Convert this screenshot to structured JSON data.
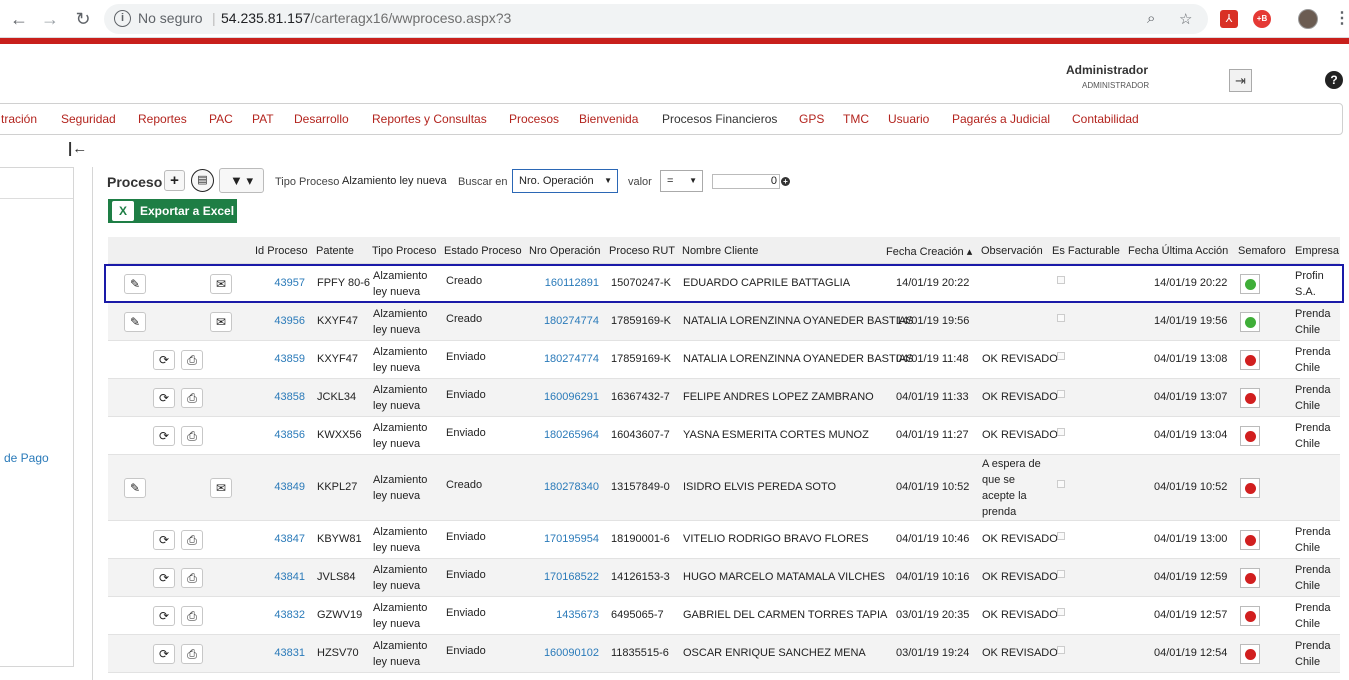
{
  "browser": {
    "security_label": "No seguro",
    "url_host": "54.235.81.157",
    "url_path": "/carteragx16/wwproceso.aspx?3",
    "ext_red_label": "+B"
  },
  "header": {
    "user_name": "Administrador",
    "user_role": "ADMINISTRADOR"
  },
  "menu": {
    "items": [
      "tración",
      "Seguridad",
      "Reportes",
      "PAC",
      "PAT",
      "Desarrollo",
      "Reportes y Consultas",
      "Procesos",
      "Bienvenida",
      "Procesos Financieros",
      "GPS",
      "TMC",
      "Usuario",
      "Pagarés a Judicial",
      "Contabilidad"
    ]
  },
  "sidebar": {
    "link": "de Pago"
  },
  "toolbar": {
    "title": "Proceso",
    "tipo_label": "Tipo Proceso",
    "tipo_value": "Alzamiento ley nueva",
    "buscar_label": "Buscar en",
    "buscar_value": "Nro. Operación",
    "valor_label": "valor",
    "operator_value": "=",
    "input_value": "0",
    "export_label": "Exportar a Excel"
  },
  "grid": {
    "headers": [
      "Id Proceso",
      "Patente",
      "Tipo Proceso",
      "Estado Proceso",
      "Nro Operación",
      "Proceso RUT",
      "Nombre Cliente",
      "Fecha Creación ▴",
      "Observación",
      "Es Facturable",
      "Fecha Última Acción",
      "Semaforo",
      "Empresa"
    ],
    "rows": [
      {
        "id": "43957",
        "patente": "FPFY 80-6",
        "tipo": "Alzamiento ley nueva",
        "estado": "Creado",
        "nro": "160112891",
        "rut": "15070247-K",
        "cliente": "EDUARDO CAPRILE BATTAGLIA",
        "fecha": "14/01/19 20:22",
        "obs": "",
        "ultima": "14/01/19 20:22",
        "semaforo": "green",
        "empresa": "Profin S.A."
      },
      {
        "id": "43956",
        "patente": "KXYF47",
        "tipo": "Alzamiento ley nueva",
        "estado": "Creado",
        "nro": "180274774",
        "rut": "17859169-K",
        "cliente": "NATALIA LORENZINNA OYANEDER BASTIAS",
        "fecha": "14/01/19 19:56",
        "obs": "",
        "ultima": "14/01/19 19:56",
        "semaforo": "green",
        "empresa": "Prenda Chile"
      },
      {
        "id": "43859",
        "patente": "KXYF47",
        "tipo": "Alzamiento ley nueva",
        "estado": "Enviado",
        "nro": "180274774",
        "rut": "17859169-K",
        "cliente": "NATALIA LORENZINNA OYANEDER BASTIAS",
        "fecha": "04/01/19 11:48",
        "obs": "OK REVISADO",
        "ultima": "04/01/19 13:08",
        "semaforo": "red",
        "empresa": "Prenda Chile"
      },
      {
        "id": "43858",
        "patente": "JCKL34",
        "tipo": "Alzamiento ley nueva",
        "estado": "Enviado",
        "nro": "160096291",
        "rut": "16367432-7",
        "cliente": "FELIPE ANDRES LOPEZ ZAMBRANO",
        "fecha": "04/01/19 11:33",
        "obs": "OK REVISADO",
        "ultima": "04/01/19 13:07",
        "semaforo": "red",
        "empresa": "Prenda Chile"
      },
      {
        "id": "43856",
        "patente": "KWXX56",
        "tipo": "Alzamiento ley nueva",
        "estado": "Enviado",
        "nro": "180265964",
        "rut": "16043607-7",
        "cliente": "YASNA ESMERITA CORTES MUNOZ",
        "fecha": "04/01/19 11:27",
        "obs": "OK REVISADO",
        "ultima": "04/01/19 13:04",
        "semaforo": "red",
        "empresa": "Prenda Chile"
      },
      {
        "id": "43849",
        "patente": "KKPL27",
        "tipo": "Alzamiento ley nueva",
        "estado": "Creado",
        "nro": "180278340",
        "rut": "13157849-0",
        "cliente": "ISIDRO ELVIS PEREDA SOTO",
        "fecha": "04/01/19 10:52",
        "obs": "A espera de que se acepte la prenda",
        "ultima": "04/01/19 10:52",
        "semaforo": "red",
        "empresa": ""
      },
      {
        "id": "43847",
        "patente": "KBYW81",
        "tipo": "Alzamiento ley nueva",
        "estado": "Enviado",
        "nro": "170195954",
        "rut": "18190001-6",
        "cliente": "VITELIO RODRIGO BRAVO FLORES",
        "fecha": "04/01/19 10:46",
        "obs": "OK REVISADO",
        "ultima": "04/01/19 13:00",
        "semaforo": "red",
        "empresa": "Prenda Chile"
      },
      {
        "id": "43841",
        "patente": "JVLS84",
        "tipo": "Alzamiento ley nueva",
        "estado": "Enviado",
        "nro": "170168522",
        "rut": "14126153-3",
        "cliente": "HUGO MARCELO MATAMALA VILCHES",
        "fecha": "04/01/19 10:16",
        "obs": "OK REVISADO",
        "ultima": "04/01/19 12:59",
        "semaforo": "red",
        "empresa": "Prenda Chile"
      },
      {
        "id": "43832",
        "patente": "GZWV19",
        "tipo": "Alzamiento ley nueva",
        "estado": "Enviado",
        "nro": "1435673",
        "rut": "6495065-7",
        "cliente": "GABRIEL DEL CARMEN TORRES TAPIA",
        "fecha": "03/01/19 20:35",
        "obs": "OK REVISADO",
        "ultima": "04/01/19 12:57",
        "semaforo": "red",
        "empresa": "Prenda Chile"
      },
      {
        "id": "43831",
        "patente": "HZSV70",
        "tipo": "Alzamiento ley nueva",
        "estado": "Enviado",
        "nro": "160090102",
        "rut": "11835515-6",
        "cliente": "OSCAR ENRIQUE SANCHEZ MENA",
        "fecha": "03/01/19 19:24",
        "obs": "OK REVISADO",
        "ultima": "04/01/19 12:54",
        "semaforo": "red",
        "empresa": "Prenda Chile"
      }
    ]
  },
  "colors": {
    "brand_red": "#c8201c",
    "link_blue": "#2a7ab9",
    "green": "#3fae38",
    "red": "#d11f1f"
  },
  "icons": [
    "back-icon",
    "forward-icon",
    "reload-icon",
    "info-icon",
    "zoom-icon",
    "star-icon",
    "edit-icon",
    "mail-icon",
    "sync-icon",
    "send-doc-icon",
    "filter-icon",
    "add-icon",
    "logout-icon",
    "help-icon"
  ]
}
